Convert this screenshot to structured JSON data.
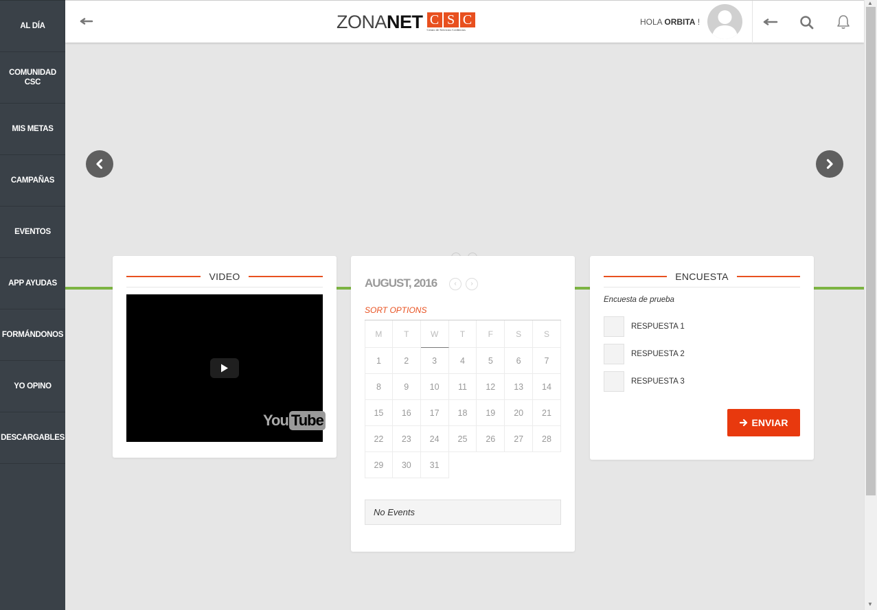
{
  "sidebar": {
    "items": [
      {
        "label": "AL DÍA"
      },
      {
        "label": "COMUNIDAD CSC"
      },
      {
        "label": "MIS METAS"
      },
      {
        "label": "CAMPAÑAS"
      },
      {
        "label": "EVENTOS"
      },
      {
        "label": "APP AYUDAS"
      },
      {
        "label": "FORMÁNDONOS"
      },
      {
        "label": "YO OPINO"
      },
      {
        "label": "DESCARGABLES"
      }
    ]
  },
  "header": {
    "logo": {
      "zona": "ZONA",
      "net": "NET",
      "csc_letters": [
        "C",
        "S",
        "C"
      ],
      "csc_subtitle": "Centro de Servicios Crediticios"
    },
    "greeting_prefix": "HOLA",
    "user_name": "ORBITA",
    "greeting_suffix": " !"
  },
  "video_card": {
    "title": "VIDEO",
    "youtube_you": "You",
    "youtube_tube": "Tube"
  },
  "calendar": {
    "month_label": "AUGUST, 2016",
    "prev_icon": "‹",
    "next_icon": "›",
    "sort_label": "SORT OPTIONS",
    "weekdays": [
      "M",
      "T",
      "W",
      "T",
      "F",
      "S",
      "S"
    ],
    "weeks": [
      [
        "1",
        "2",
        "3",
        "4",
        "5",
        "6",
        "7"
      ],
      [
        "8",
        "9",
        "10",
        "11",
        "12",
        "13",
        "14"
      ],
      [
        "15",
        "16",
        "17",
        "18",
        "19",
        "20",
        "21"
      ],
      [
        "22",
        "23",
        "24",
        "25",
        "26",
        "27",
        "28"
      ],
      [
        "29",
        "30",
        "31",
        "",
        "",
        "",
        ""
      ]
    ],
    "no_events": "No Events"
  },
  "survey": {
    "title": "ENCUESTA",
    "question": "Encuesta de prueba",
    "options": [
      {
        "label": "RESPUESTA 1"
      },
      {
        "label": "RESPUESTA 2"
      },
      {
        "label": "RESPUESTA 3"
      }
    ],
    "submit_label": "ENVIAR"
  },
  "colors": {
    "accent": "#e8501f",
    "button": "#e8390e",
    "green_line": "#7cb342",
    "sidebar": "#3a4148"
  }
}
